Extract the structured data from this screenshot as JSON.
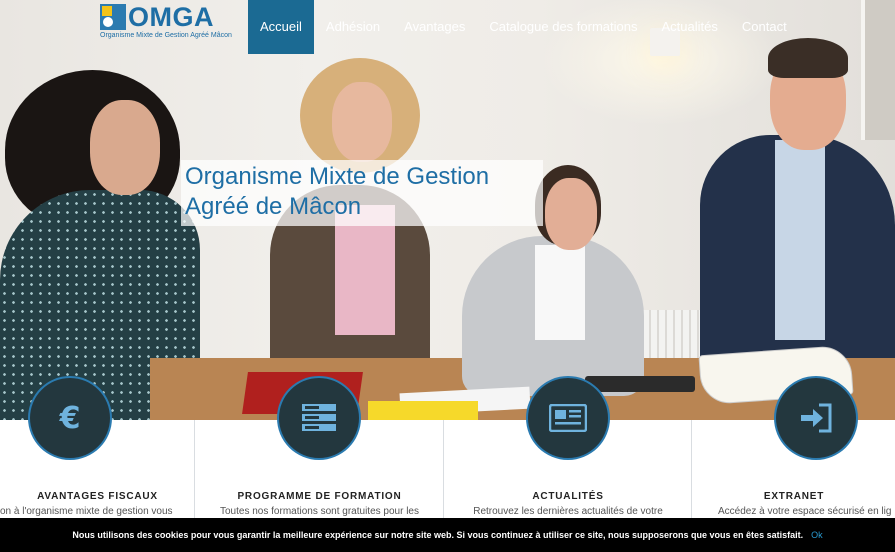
{
  "logo": {
    "text": "OMGA",
    "subtitle": "Organisme Mixte de Gestion Agréé Mâcon"
  },
  "nav": {
    "items": [
      {
        "label": "Accueil",
        "active": true
      },
      {
        "label": "Adhésion"
      },
      {
        "label": "Avantages"
      },
      {
        "label": "Catalogue des formations"
      },
      {
        "label": "Actualités"
      },
      {
        "label": "Contact"
      }
    ]
  },
  "hero": {
    "title_line1": "Organisme Mixte de Gestion",
    "title_line2": "Agréé de Mâcon"
  },
  "features": [
    {
      "icon": "euro-icon",
      "title": "AVANTAGES FISCAUX",
      "text": "on à l'organisme mixte de gestion vous"
    },
    {
      "icon": "server-icon",
      "title": "PROGRAMME DE FORMATION",
      "text": "Toutes nos formations sont gratuites pour les"
    },
    {
      "icon": "newspaper-icon",
      "title": "ACTUALITÉS",
      "text": "Retrouvez les dernières actualités de votre"
    },
    {
      "icon": "sign-in-icon",
      "title": "EXTRANET",
      "text": "Accédez à votre espace sécurisé en lig"
    }
  ],
  "cookie": {
    "message": "Nous utilisons des cookies pour vous garantir la meilleure expérience sur notre site web. Si vous continuez à utiliser ce site, nous supposerons que vous en êtes satisfait.",
    "ok_label": "Ok"
  },
  "colors": {
    "primary": "#1b6a93",
    "circle": "#23373e",
    "accent_icon": "#6fb3de"
  }
}
